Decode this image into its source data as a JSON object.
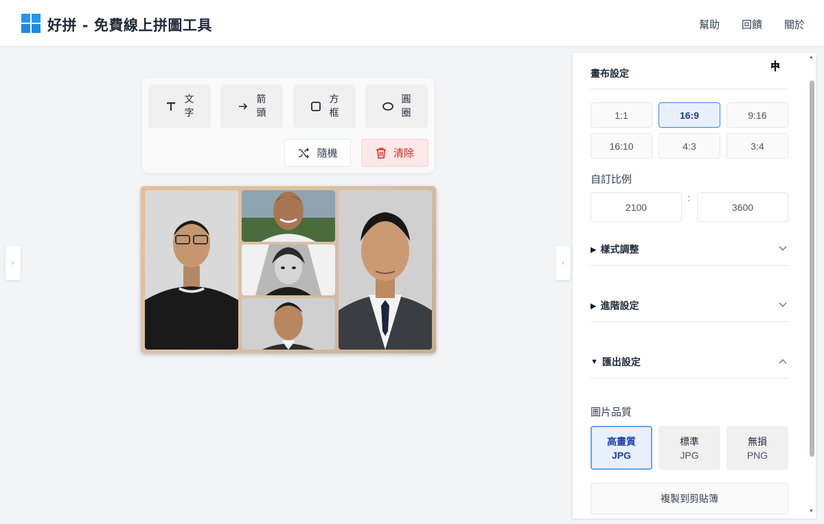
{
  "app": {
    "title": "好拼 - 免費線上拼圖工具"
  },
  "nav": {
    "help": "幫助",
    "feedback": "回饋",
    "about": "關於"
  },
  "tools": [
    {
      "id": "text",
      "label": "文字",
      "icon": "text-icon"
    },
    {
      "id": "arrow",
      "label": "箭頭",
      "icon": "arrow-icon"
    },
    {
      "id": "box",
      "label": "方框",
      "icon": "square-icon"
    },
    {
      "id": "circle",
      "label": "圓圈",
      "icon": "ellipse-icon"
    }
  ],
  "actions": {
    "random": "隨機",
    "clear": "清除"
  },
  "panel": {
    "canvas_title": "畫布設定",
    "ratios": [
      "1:1",
      "16:9",
      "9:16",
      "16:10",
      "4:3",
      "3:4"
    ],
    "active_ratio": "16:9",
    "custom_label": "自訂比例",
    "custom_w": "2100",
    "custom_h": "3600",
    "colon": ":",
    "style_section": "樣式調整",
    "advanced_section": "進階設定",
    "export_section": "匯出設定",
    "quality_label": "圖片品質",
    "quality": [
      {
        "top": "高畫質",
        "bottom": "JPG",
        "active": true
      },
      {
        "top": "標準",
        "bottom": "JPG",
        "active": false
      },
      {
        "top": "無損",
        "bottom": "PNG",
        "active": false
      }
    ],
    "copy_button": "複製到剪貼簿"
  },
  "colors": {
    "accent": "#3b82f6",
    "danger": "#dc2626",
    "logo": "#1e88e5"
  }
}
